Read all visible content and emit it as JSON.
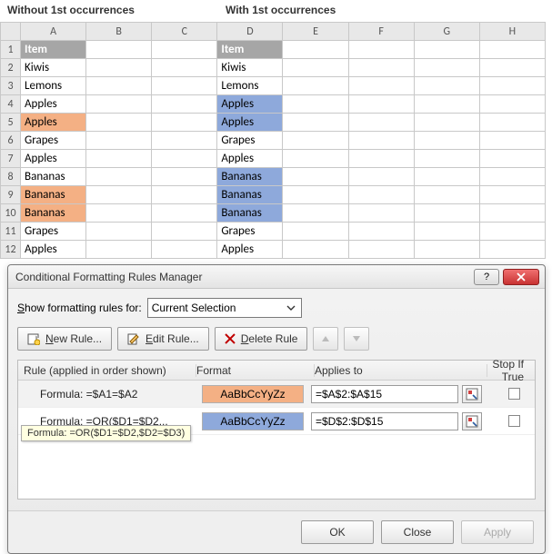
{
  "labels": {
    "without": "Without 1st occurrences",
    "with": "With 1st occurrences"
  },
  "columns": [
    "A",
    "B",
    "C",
    "D",
    "E",
    "F",
    "G",
    "H"
  ],
  "rowNumbers": [
    1,
    2,
    3,
    4,
    5,
    6,
    7,
    8,
    9,
    10,
    11,
    12
  ],
  "grid": {
    "A": [
      "Item",
      "Kiwis",
      "Lemons",
      "Apples",
      "Apples",
      "Grapes",
      "Apples",
      "Bananas",
      "Bananas",
      "Bananas",
      "Grapes",
      "Apples"
    ],
    "D": [
      "Item",
      "Kiwis",
      "Lemons",
      "Apples",
      "Apples",
      "Grapes",
      "Apples",
      "Bananas",
      "Bananas",
      "Bananas",
      "Grapes",
      "Apples"
    ]
  },
  "highlight": {
    "A_orange_rows": [
      5,
      9,
      10
    ],
    "D_blue_rows": [
      4,
      5,
      8,
      9,
      10
    ]
  },
  "dialog": {
    "title": "Conditional Formatting Rules Manager",
    "showFor_label": "Show formatting rules for:",
    "showFor_value": "Current Selection",
    "buttons": {
      "new": "New Rule...",
      "edit": "Edit Rule...",
      "delete": "Delete Rule"
    },
    "header": {
      "rule": "Rule (applied in order shown)",
      "format": "Format",
      "applies": "Applies to",
      "stop": "Stop If True"
    },
    "sample": "AaBbCcYyZz",
    "rules": [
      {
        "text": "Formula: =$A1=$A2",
        "swatch": "orange",
        "applies": "=$A$2:$A$15",
        "stop": false,
        "selected": true
      },
      {
        "text": "Formula: =OR($D1=$D2...",
        "swatch": "blue",
        "applies": "=$D$2:$D$15",
        "stop": false,
        "selected": false
      }
    ],
    "tooltip": "Formula: =OR($D1=$D2,$D2=$D3)",
    "footer": {
      "ok": "OK",
      "close": "Close",
      "apply": "Apply"
    }
  }
}
